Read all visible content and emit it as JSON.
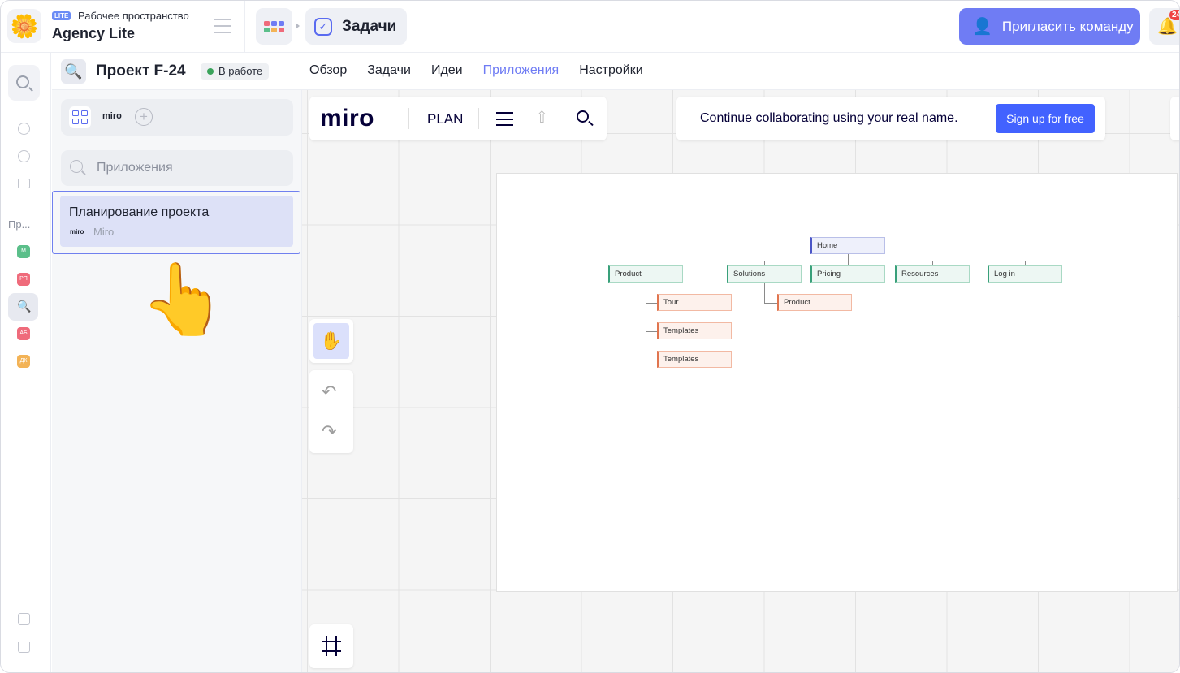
{
  "workspace": {
    "badge": "LITE",
    "subtitle": "Рабочее пространство",
    "name": "Agency Lite"
  },
  "topbar": {
    "current_section": "Задачи",
    "invite_label": "Пригласить команду",
    "notifications_count": "24"
  },
  "rail": {
    "section_label": "Пр...",
    "projects": [
      {
        "initials": "М",
        "color": "#5bbf8a"
      },
      {
        "initials": "РП",
        "color": "#ef6b7b"
      },
      {
        "initials": "АБ",
        "color": "#ef6b7b"
      },
      {
        "initials": "ДК",
        "color": "#f3b356"
      }
    ]
  },
  "project": {
    "title": "Проект F-24",
    "status": "В работе",
    "tabs": [
      "Обзор",
      "Задачи",
      "Идеи",
      "Приложения",
      "Настройки"
    ],
    "active_tab": "Приложения"
  },
  "apps_panel": {
    "miro_tab_label": "miro",
    "search_placeholder": "Приложения",
    "items": [
      {
        "title": "Планирование проекта",
        "source_logo": "miro",
        "source": "Miro"
      }
    ]
  },
  "miro": {
    "brand": "miro",
    "board_name": "PLAN",
    "collab_message": "Continue collaborating using your real name.",
    "signup_label": "Sign up for free"
  },
  "sitemap": {
    "home": "Home",
    "top": [
      "Product",
      "Solutions",
      "Pricing",
      "Resources",
      "Log in"
    ],
    "product_children": [
      "Tour",
      "Templates",
      "Templates"
    ],
    "solutions_children": [
      "Product"
    ]
  },
  "colors": {
    "accent": "#6f7cf4",
    "miro_blue": "#4262ff"
  }
}
